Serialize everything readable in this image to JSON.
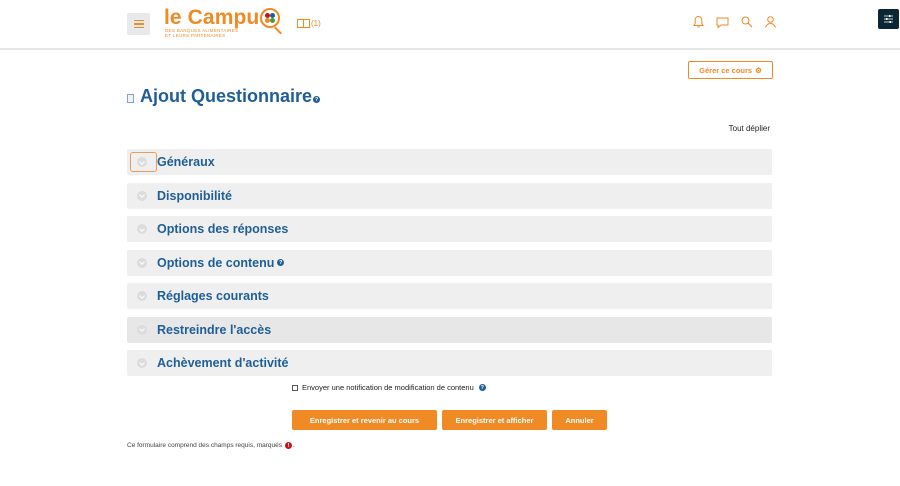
{
  "header": {
    "logo_title": "le Campus",
    "logo_subtitle_line1": "DES BANQUES ALIMENTAIRES",
    "logo_subtitle_line2": "ET LEURS PARTENAIRES",
    "reader_count": "(1)",
    "icons": [
      "menu-icon",
      "book-reader-icon",
      "bell-icon",
      "chat-icon",
      "search-icon",
      "user-icon",
      "sliders-icon"
    ],
    "accent_color": "#f08a24"
  },
  "manage_course_label": "Gérer ce cours",
  "page": {
    "title": "Ajout Questionnaire",
    "expand_all": "Tout déplier"
  },
  "sections": [
    {
      "label": "Généraux"
    },
    {
      "label": "Disponibilité"
    },
    {
      "label": "Options des réponses"
    },
    {
      "label": "Options de contenu"
    },
    {
      "label": "Réglages courants"
    },
    {
      "label": "Restreindre l'accès"
    },
    {
      "label": "Achèvement d'activité"
    }
  ],
  "notify_label": "Envoyer une notification de modification de contenu",
  "buttons": {
    "save_return": "Enregistrer et revenir au cours",
    "save_display": "Enregistrer et afficher",
    "cancel": "Annuler"
  },
  "footnote": "Ce formulaire comprend des champs requis, marqués",
  "colors": {
    "title_blue": "#1f5e96",
    "required_red": "#c4161c",
    "sidebar_dark": "#0c2733"
  }
}
